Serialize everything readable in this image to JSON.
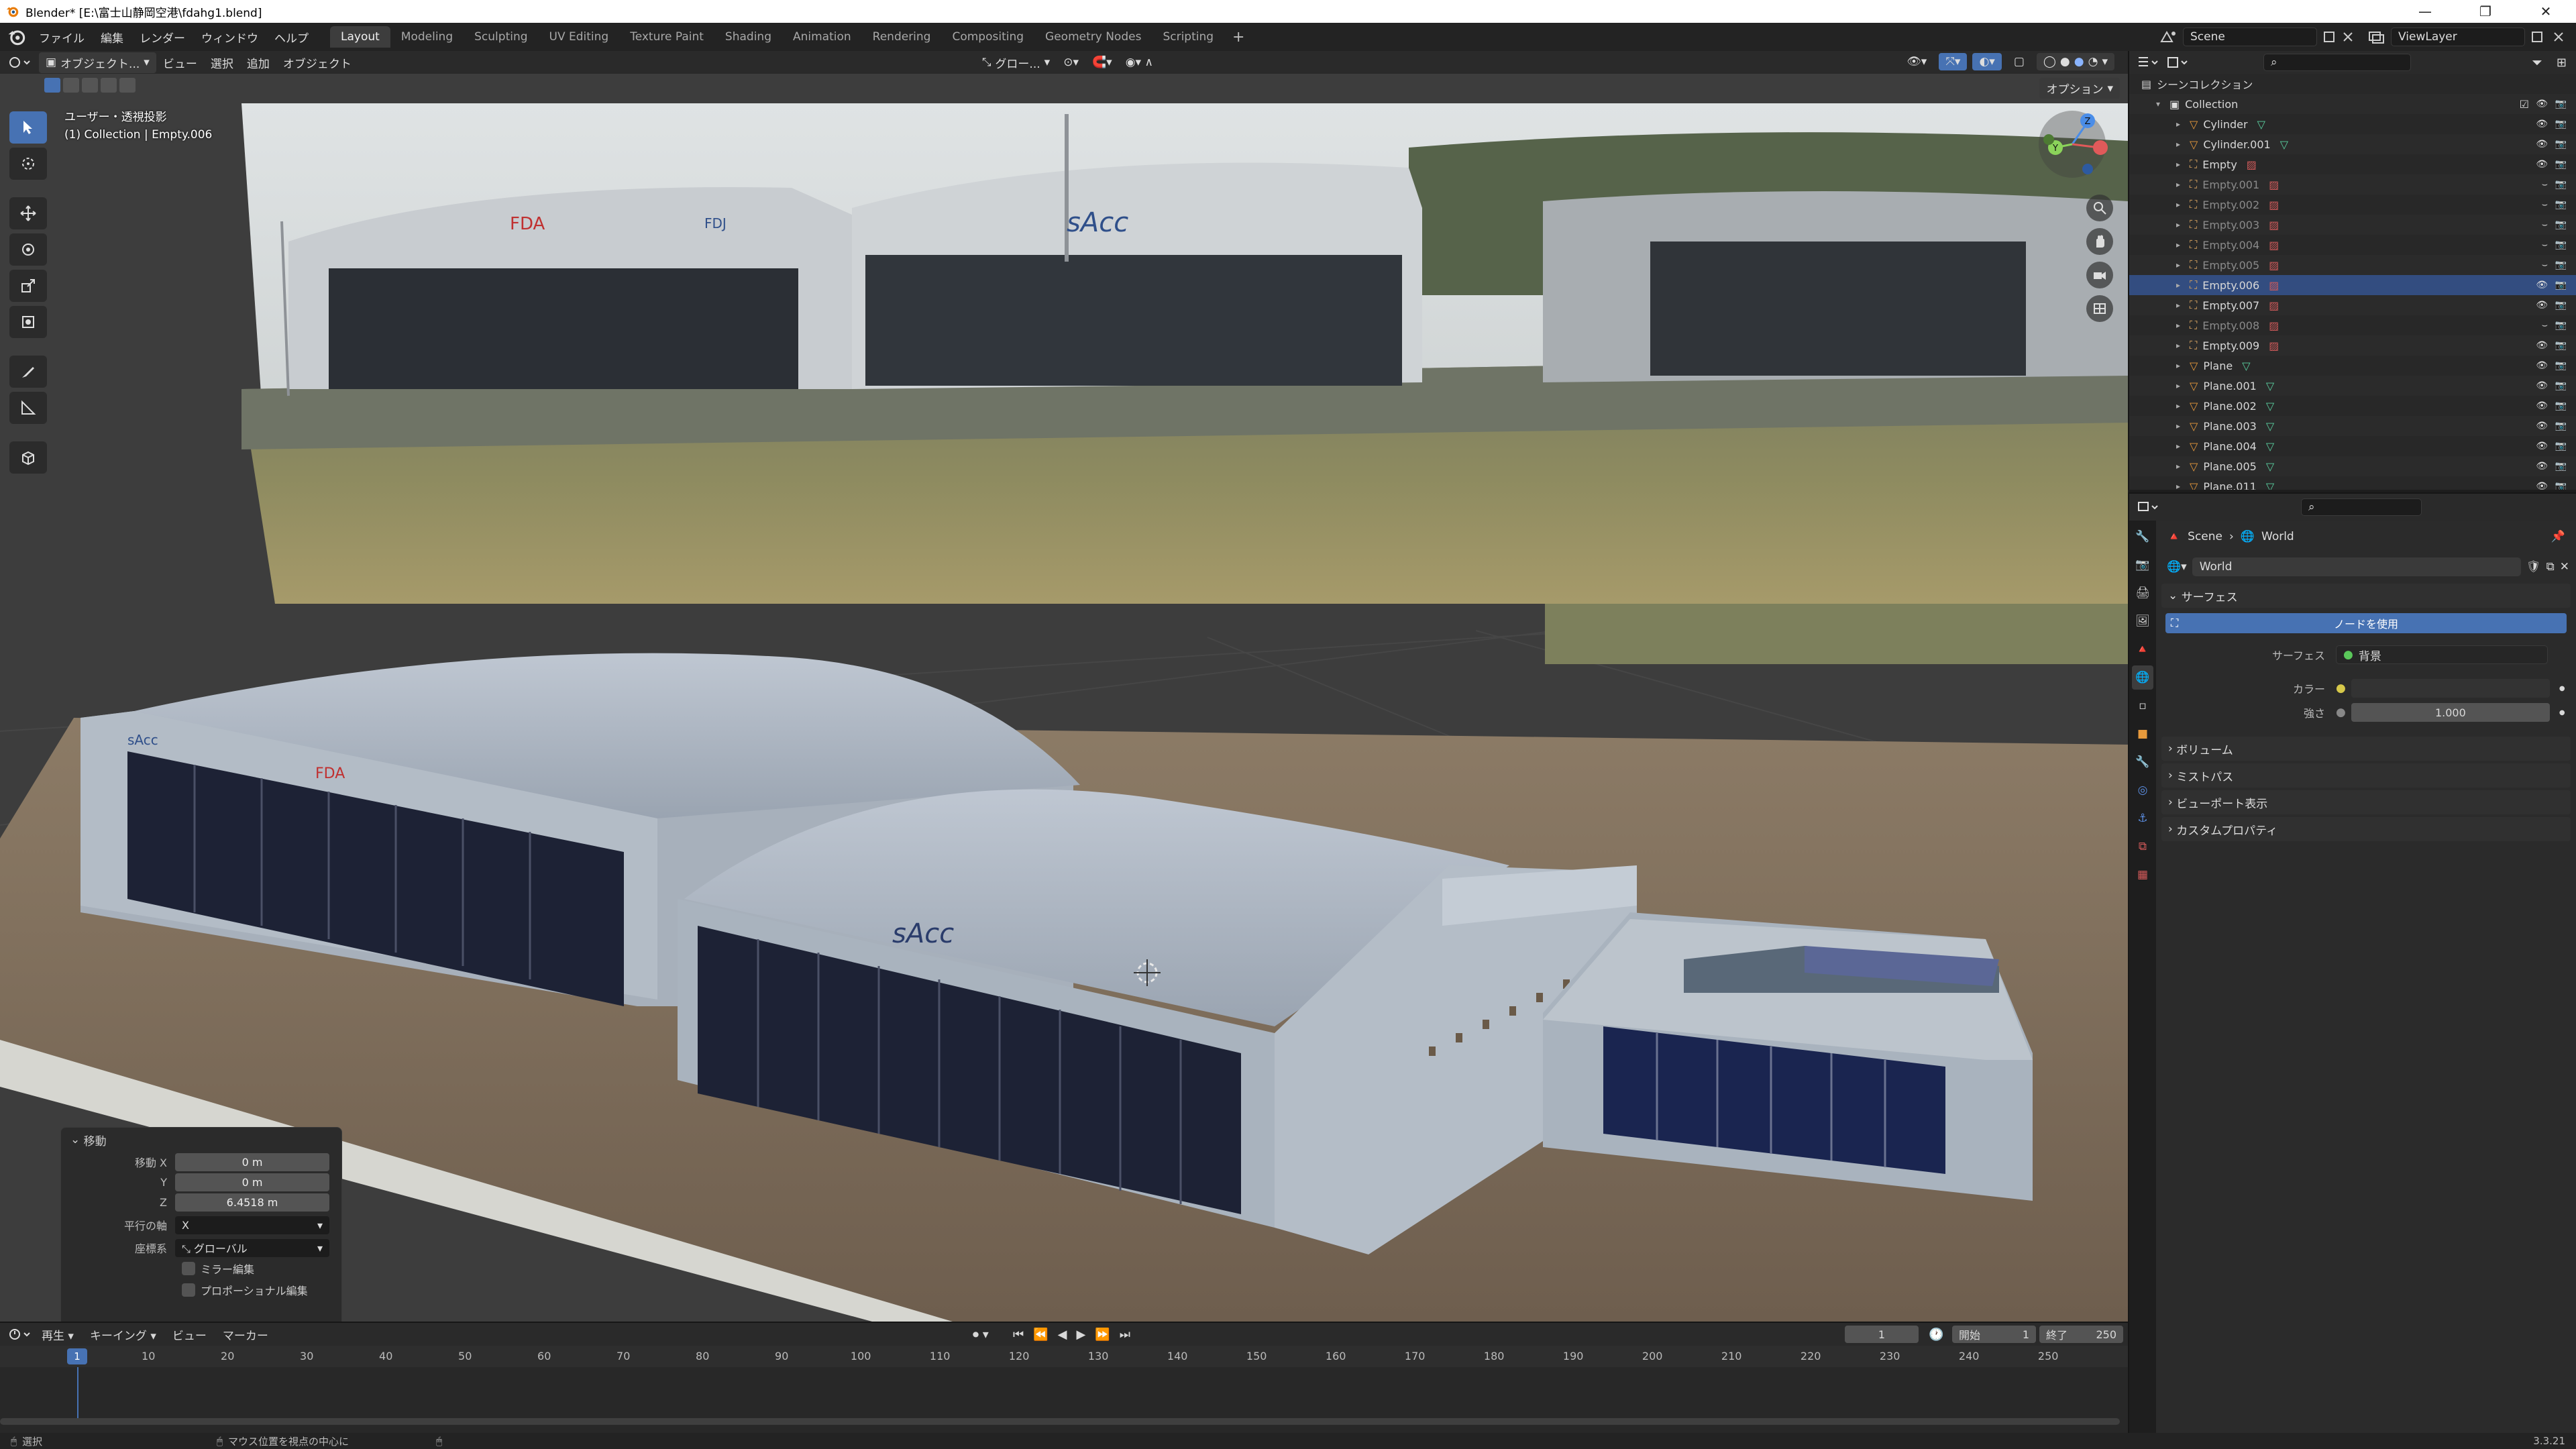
{
  "window": {
    "title": "Blender* [E:\\富士山静岡空港\\fdahg1.blend]",
    "min": "—",
    "max": "❐",
    "close": "✕"
  },
  "menus": [
    "ファイル",
    "編集",
    "レンダー",
    "ウィンドウ",
    "ヘルプ"
  ],
  "workspaces": [
    "Layout",
    "Modeling",
    "Sculpting",
    "UV Editing",
    "Texture Paint",
    "Shading",
    "Animation",
    "Rendering",
    "Compositing",
    "Geometry Nodes",
    "Scripting"
  ],
  "active_workspace": "Layout",
  "add_tab": "+",
  "scene_name": "Scene",
  "view_layer": "ViewLayer",
  "viewport": {
    "mode": "オブジェクト...",
    "menu_view": "ビュー",
    "menu_select": "選択",
    "menu_add": "追加",
    "menu_object": "オブジェクト",
    "transform": "グロー...",
    "options": "オプション",
    "view_label": "ユーザー・透視投影",
    "context_label": "(1) Collection | Empty.006"
  },
  "signage": {
    "fda_logo": "FDA",
    "sacc_logo": "sAcc",
    "fdj_logo": "FDJ"
  },
  "operator": {
    "title": "移動",
    "move_x_label": "移動 X",
    "move_x": "0 m",
    "move_y_label": "Y",
    "move_y": "0 m",
    "move_z_label": "Z",
    "move_z": "6.4518 m",
    "axis_label": "平行の軸",
    "axis_value": "X",
    "orient_label": "座標系",
    "orient_value": "グローバル",
    "mirror": "ミラー編集",
    "proportional": "プロポーショナル編集"
  },
  "outliner": {
    "scene_collection": "シーンコレクション",
    "collection": "Collection",
    "items": [
      {
        "name": "Cylinder",
        "type": "mesh",
        "dim": false,
        "sel": false
      },
      {
        "name": "Cylinder.001",
        "type": "mesh",
        "dim": false,
        "sel": false
      },
      {
        "name": "Empty",
        "type": "empty",
        "dim": false,
        "sel": false
      },
      {
        "name": "Empty.001",
        "type": "empty",
        "dim": true,
        "sel": false
      },
      {
        "name": "Empty.002",
        "type": "empty",
        "dim": true,
        "sel": false
      },
      {
        "name": "Empty.003",
        "type": "empty",
        "dim": true,
        "sel": false
      },
      {
        "name": "Empty.004",
        "type": "empty",
        "dim": true,
        "sel": false
      },
      {
        "name": "Empty.005",
        "type": "empty",
        "dim": true,
        "sel": false
      },
      {
        "name": "Empty.006",
        "type": "empty",
        "dim": false,
        "sel": true
      },
      {
        "name": "Empty.007",
        "type": "empty",
        "dim": false,
        "sel": false
      },
      {
        "name": "Empty.008",
        "type": "empty",
        "dim": true,
        "sel": false
      },
      {
        "name": "Empty.009",
        "type": "empty",
        "dim": false,
        "sel": false
      },
      {
        "name": "Plane",
        "type": "mesh",
        "dim": false,
        "sel": false
      },
      {
        "name": "Plane.001",
        "type": "mesh",
        "dim": false,
        "sel": false
      },
      {
        "name": "Plane.002",
        "type": "mesh",
        "dim": false,
        "sel": false
      },
      {
        "name": "Plane.003",
        "type": "mesh",
        "dim": false,
        "sel": false
      },
      {
        "name": "Plane.004",
        "type": "mesh",
        "dim": false,
        "sel": false
      },
      {
        "name": "Plane.005",
        "type": "mesh",
        "dim": false,
        "sel": false
      },
      {
        "name": "Plane.011",
        "type": "mesh",
        "dim": false,
        "sel": false
      }
    ]
  },
  "properties": {
    "crumb_scene": "Scene",
    "crumb_world": "World",
    "world_name": "World",
    "surface_panel": "サーフェス",
    "use_nodes": "ノードを使用",
    "surface_label": "サーフェス",
    "surface_value": "背景",
    "color_label": "カラー",
    "strength_label": "強さ",
    "strength_value": "1.000",
    "volume_panel": "ボリューム",
    "mist_panel": "ミストパス",
    "viewport_display_panel": "ビューポート表示",
    "custom_props_panel": "カスタムプロパティ"
  },
  "timeline": {
    "playback": "再生",
    "keying": "キーイング",
    "view": "ビュー",
    "marker": "マーカー",
    "current_frame": "1",
    "start_label": "開始",
    "start": "1",
    "end_label": "終了",
    "end": "250",
    "ticks": [
      "10",
      "20",
      "30",
      "40",
      "50",
      "60",
      "70",
      "80",
      "90",
      "100",
      "110",
      "120",
      "130",
      "140",
      "150",
      "160",
      "170",
      "180",
      "190",
      "200",
      "210",
      "220",
      "230",
      "240",
      "250"
    ],
    "cursor": "1"
  },
  "status": {
    "select": "選択",
    "center_view": "マウス位置を視点の中心に",
    "version": "3.3.21"
  }
}
